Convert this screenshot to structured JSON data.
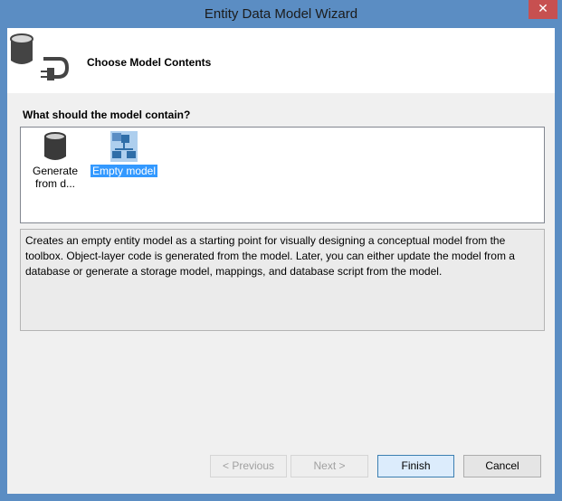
{
  "window": {
    "title": "Entity Data Model Wizard",
    "close_label": "✕"
  },
  "header": {
    "title": "Choose Model Contents"
  },
  "question": "What should the model contain?",
  "options": [
    {
      "label": "Generate from d...",
      "selected": false
    },
    {
      "label": "Empty model",
      "selected": true
    }
  ],
  "description": "Creates an empty entity model as a starting point for visually designing a conceptual model from the toolbox. Object-layer code is generated from the model. Later, you can either update the model from a database or generate a storage model, mappings, and database script from the model.",
  "buttons": {
    "previous": "< Previous",
    "next": "Next >",
    "finish": "Finish",
    "cancel": "Cancel"
  }
}
